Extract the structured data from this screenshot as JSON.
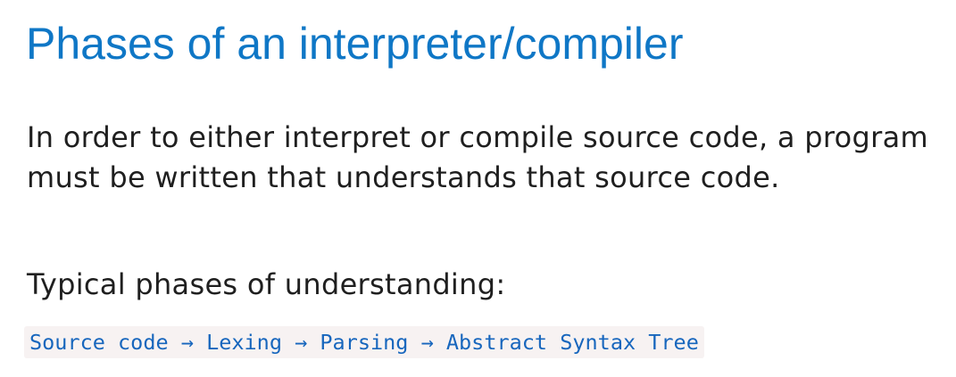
{
  "slide": {
    "title": "Phases of an interpreter/compiler",
    "paragraph1": "In order to either interpret or compile source code, a program must be written that understands that source code.",
    "paragraph2": "Typical phases of understanding:",
    "pipeline_code": "Source code → Lexing → Parsing → Abstract Syntax Tree"
  },
  "colors": {
    "title": "#0f77c6",
    "body_text": "#1f1f1f",
    "code_text": "#1766bd",
    "code_background": "#f7f2f2",
    "page_background": "#ffffff"
  }
}
